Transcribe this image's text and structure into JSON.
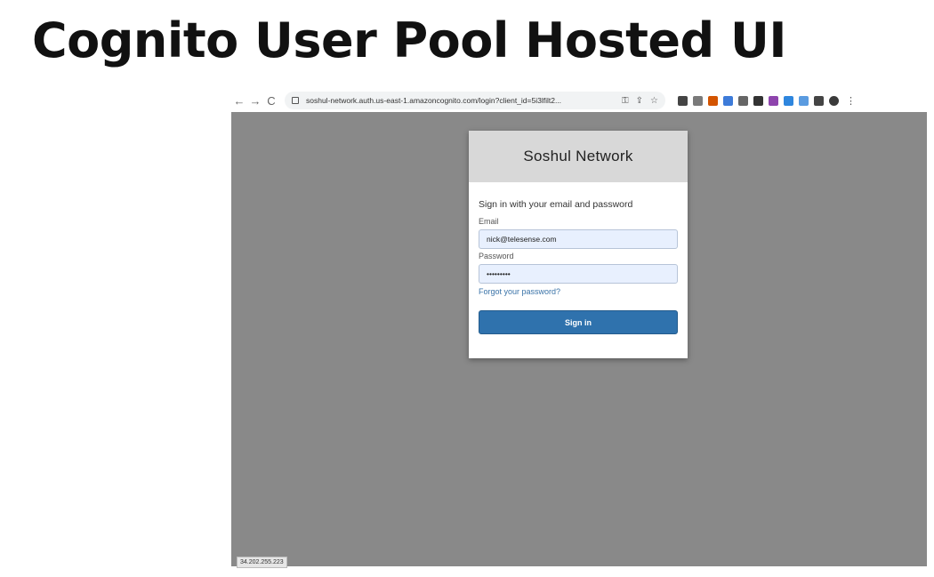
{
  "slide": {
    "title": "Cognito User Pool Hosted UI"
  },
  "browser": {
    "url": "soshul-network.auth.us-east-1.amazoncognito.com/login?client_id=5i3lfilt2...",
    "back_icon": "←",
    "forward_icon": "→",
    "reload_icon": "C",
    "key_icon": "⚿",
    "share_icon": "⇪",
    "star_icon": "☆",
    "menu_icon": "⋮",
    "extension_colors": [
      "#444444",
      "#7a7a7a",
      "#d35400",
      "#3d7bd9",
      "#666666",
      "#333333",
      "#8e44ad",
      "#2e86de",
      "#5a9be0",
      "#444444",
      "#3a3a3a"
    ]
  },
  "login": {
    "brand": "Soshul Network",
    "heading": "Sign in with your email and password",
    "email_label": "Email",
    "email_value": "nick@telesense.com",
    "password_label": "Password",
    "password_value": "•••••••••",
    "forgot_link": "Forgot your password?",
    "signin_button": "Sign in"
  },
  "status": {
    "ip": "34.202.255.223"
  },
  "colors": {
    "viewport_bg": "#898989",
    "button_bg": "#2f72ad",
    "link": "#3a73a8",
    "input_bg": "#e8f0fe"
  }
}
